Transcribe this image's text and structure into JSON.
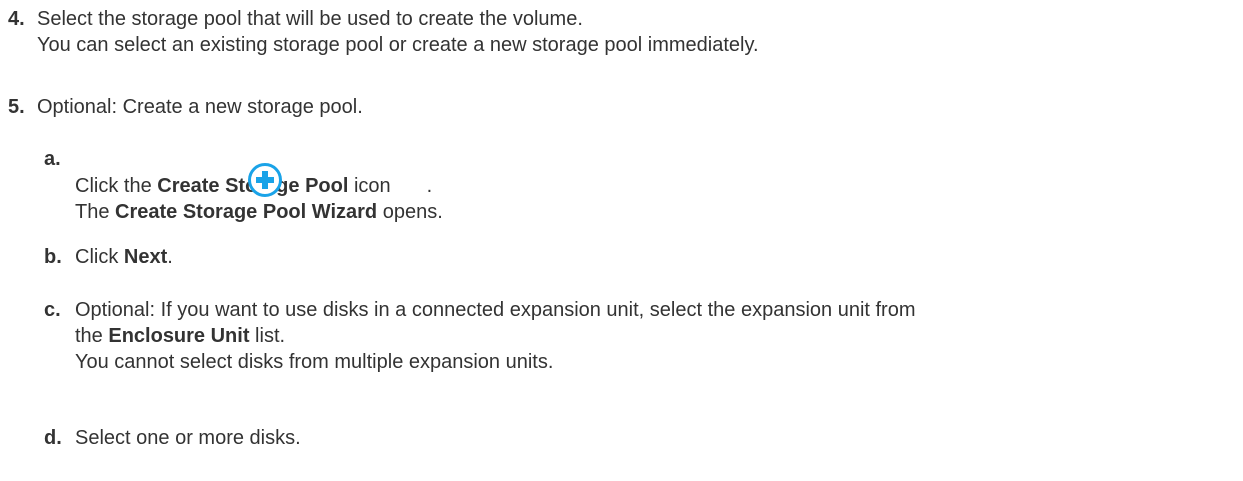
{
  "step4": {
    "num": "4.",
    "line1": "Select the storage pool that will be used to create the volume.",
    "line2": "You can select an existing storage pool or create a new storage pool immediately."
  },
  "step5": {
    "num": "5.",
    "line1": "Optional: Create a new storage pool."
  },
  "substep_a": {
    "num": "a.",
    "click": "Click the ",
    "create_pool": "Create Storage Pool",
    "icon_word": " icon",
    "period": ".",
    "the": "The ",
    "wizard": "Create Storage Pool Wizard",
    "opens": " opens.",
    "icon": "plus-circle-icon",
    "icon_color": "#1aa3e8"
  },
  "substep_b": {
    "num": "b.",
    "click": "Click ",
    "next": "Next",
    "period": "."
  },
  "substep_c": {
    "num": "c.",
    "line1": "Optional: If you want to use disks in a connected expansion unit, select the expansion unit from",
    "the": "the ",
    "enclosure": "Enclosure Unit",
    "list": " list.",
    "line3": "You cannot select disks from multiple expansion units."
  },
  "substep_d": {
    "num": "d.",
    "line1": "Select one or more disks."
  }
}
